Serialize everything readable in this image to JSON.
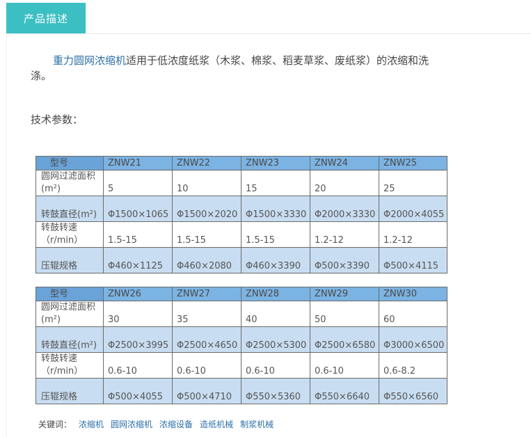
{
  "tab": {
    "label": "产品描述"
  },
  "intro": {
    "link_text": "重力圆网浓缩机",
    "rest_text": "适用于低浓度纸浆（木浆、棉浆、稻麦草浆、废纸浆）的浓缩和洗涤。"
  },
  "params_heading": "技术参数：",
  "row_labels": {
    "model": "型号",
    "area_l1": "圆网过滤面积",
    "area_l2": "(m²)",
    "diameter": "转鼓直径(m²)",
    "speed_l1": "转鼓转速",
    "speed_l2": "（r/min）",
    "roll": "压辊规格"
  },
  "table1": {
    "models": [
      "ZNW21",
      "ZNW22",
      "ZNW23",
      "ZNW24",
      "ZNW25"
    ],
    "area": [
      "5",
      "10",
      "15",
      "20",
      "25"
    ],
    "diameter": [
      "Φ1500×1065",
      "Φ1500×2020",
      "Φ1500×3330",
      "Φ2000×3330",
      "Φ2000×4055"
    ],
    "speed": [
      "1.5-15",
      "1.5-15",
      "1.5-15",
      "1.2-12",
      "1.2-12"
    ],
    "roll": [
      "Φ460×1125",
      "Φ460×2080",
      "Φ460×3390",
      "Φ500×3390",
      "Φ500×4115"
    ]
  },
  "table2": {
    "models": [
      "ZNW26",
      "ZNW27",
      "ZNW28",
      "ZNW29",
      "ZNW30"
    ],
    "area": [
      "30",
      "35",
      "40",
      "50",
      "60"
    ],
    "diameter": [
      "Φ2500×3995",
      "Φ2500×4650",
      "Φ2500×5300",
      "Φ2500×6580",
      "Φ3000×6500"
    ],
    "speed": [
      "0.6-10",
      "0.6-10",
      "0.6-10",
      "0.6-10",
      "0.6-8.2"
    ],
    "roll": [
      "Φ500×4055",
      "Φ500×4710",
      "Φ550×5360",
      "Φ550×6640",
      "Φ550×6560"
    ]
  },
  "keywords": {
    "label": "关键词：",
    "items": [
      "浓缩机",
      "圆网浓缩机",
      "浓缩设备",
      "造纸机械",
      "制浆机械"
    ]
  }
}
